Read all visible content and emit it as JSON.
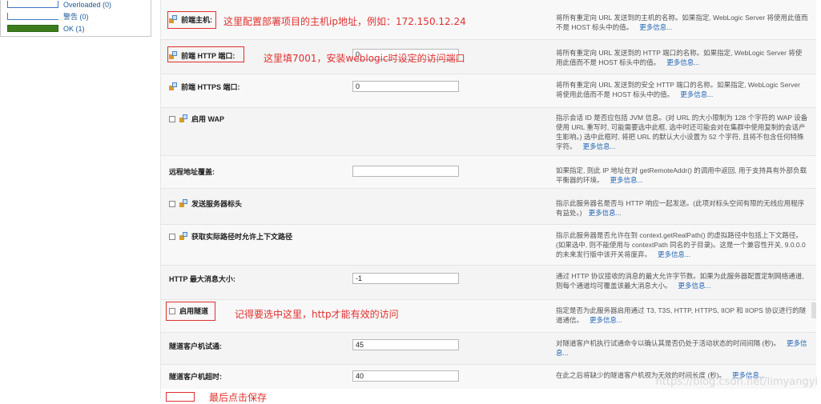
{
  "health": {
    "items": [
      {
        "label": "Overloaded (0)",
        "bar_color": "#ffffff",
        "border": "#3b78c8"
      },
      {
        "label": "警告 (0)",
        "bar_color": "#ffffff",
        "border": "#3b78c8"
      },
      {
        "label": "OK (1)",
        "bar_color": "#3c7b1e",
        "border": "#2f6a14"
      }
    ]
  },
  "more_link": "更多信息...",
  "rows": [
    {
      "label": "前端主机:",
      "value": "",
      "desc": "将所有重定向 URL 发送到的主机的名称。如果指定, WebLogic Server 将使用此值而不是 HOST 标头中的值。",
      "annotation": "这里配置部署项目的主机ip地址，例如：172.150.12.24"
    },
    {
      "label": "前端 HTTP 端口:",
      "value": "0",
      "desc": "将所有重定向 URL 发送到的 HTTP 端口的名称。如果指定, WebLogic Server 将使用此值而不是 HOST 标头中的值。",
      "annotation": "这里填7001，安装weblogic时设定的访问端口"
    },
    {
      "label": "前端 HTTPS 端口:",
      "value": "0",
      "desc": "将所有重定向 URL 发送到的安全 HTTP 端口的名称。如果指定, WebLogic Server 将使用此值而不是 HOST 标头中的值。"
    },
    {
      "label": "启用 WAP",
      "desc": "指示会话 ID 是否应包括 JVM 信息。(对 URL 的大小限制为 128 个字符的 WAP 设备使用 URL 重写时, 可能需要选中此框, 选中时还可能会对在集群中使用复制的会话产生影响。) 选中此框时, 将把 URL 的默认大小设置为 52 个字符, 且将不包含任何特殊字符。"
    },
    {
      "label": "远程地址覆盖:",
      "value": "",
      "desc": "如果指定, 则此 IP 地址在对 getRemoteAddr() 的调用中返回, 用于支持具有外部负载平衡器的环境。"
    },
    {
      "label": "发送服务器标头",
      "desc": "指示此服务器名是否与 HTTP 响应一起发送。(此项对标头空间有限的无线应用程序有益处。)"
    },
    {
      "label": "获取实际路径时允许上下文路径",
      "desc": "指示此服务器是否允许在到 context.getRealPath() 的虚拟路径中包括上下文路径。(如果选中, 则不能使用与 contextPath 同名的子目录)。这是一个兼容性开关, 9.0.0.0 的未来发行版中该开关将废弃。"
    },
    {
      "label": "HTTP 最大消息大小:",
      "value": "-1",
      "desc": "通过 HTTP 协议接收的消息的最大允许字节数。如果为此服务器配置定制网络通道, 则每个通道均可覆盖该最大消息大小。"
    },
    {
      "label": "启用隧道",
      "desc": "指定是否为此服务器启用通过 T3, T3S, HTTP, HTTPS, IIOP 和 IIOPS 协议进行的隧道通信。",
      "annotation": "记得要选中这里，http才能有效的访问"
    },
    {
      "label": "隧道客户机试通:",
      "value": "45",
      "desc": "对隧道客户机执行试通命令以确认其是否仍处于活动状态的时间间隔 (秒)。"
    },
    {
      "label": "隧道客户机超时:",
      "value": "40",
      "desc": "在此之后将缺少的隧道客户机视为无效的时间长度 (秒)。"
    }
  ],
  "bottom_annotation": "最后点击保存",
  "watermark": "https://blog.csdn.net/limyangyi"
}
